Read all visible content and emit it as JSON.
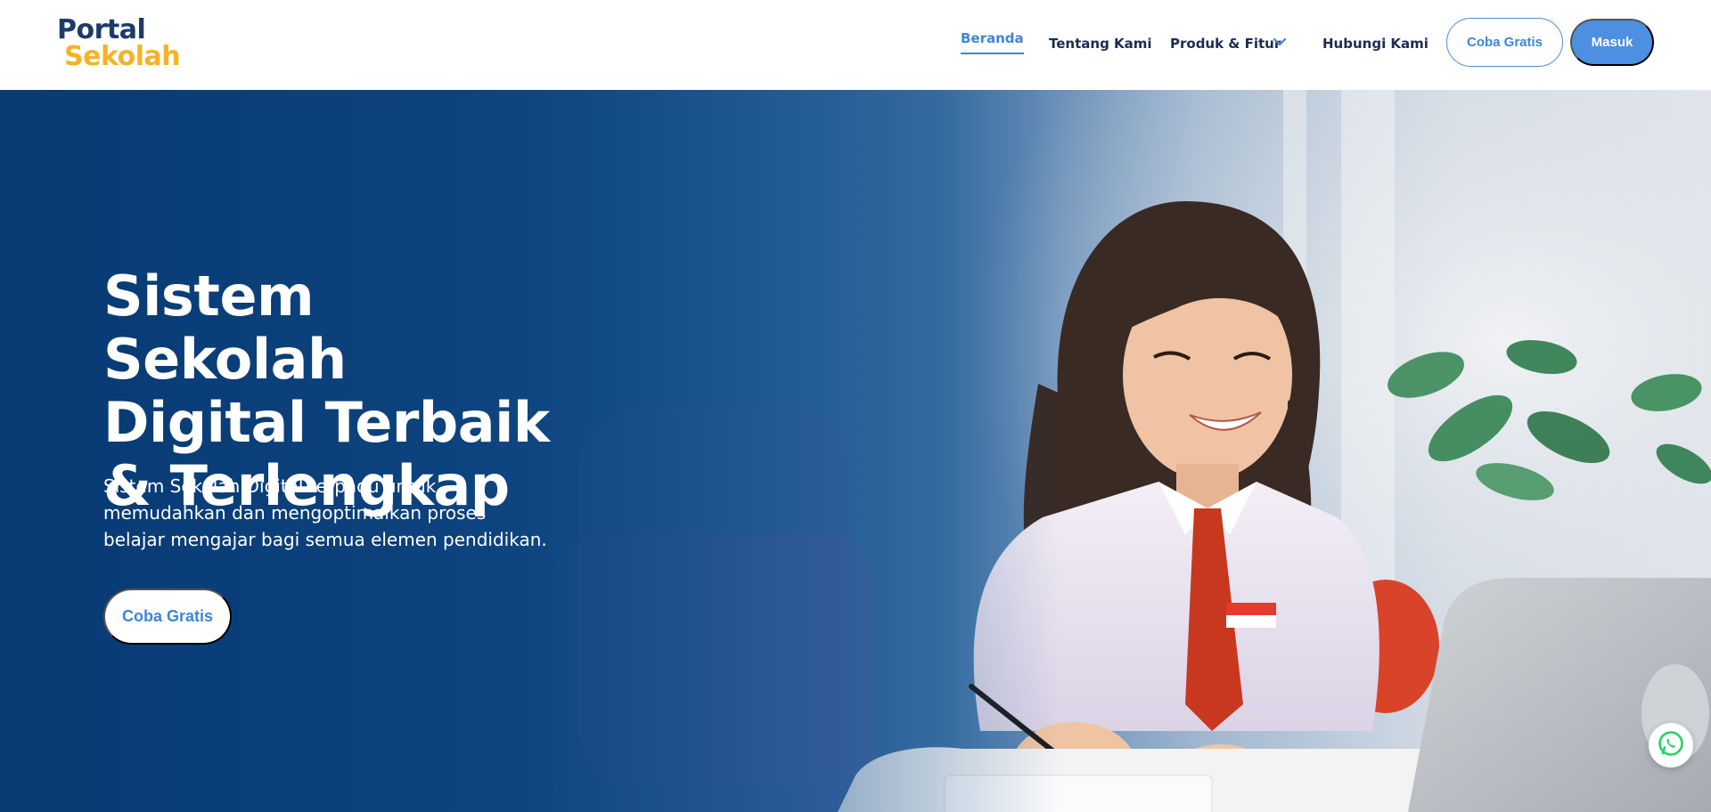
{
  "brand": {
    "line1": "Portal",
    "line2": "Sekolah",
    "color_primary": "#1e3a68",
    "color_accent": "#f5b324"
  },
  "nav": {
    "items": [
      {
        "label": "Beranda",
        "active": true
      },
      {
        "label": "Tentang Kami",
        "active": false
      },
      {
        "label": "Produk & Fitur",
        "active": false,
        "icon": "chevron-down-icon"
      },
      {
        "label": "Hubungi Kami",
        "active": false
      }
    ],
    "trial_button": "Coba Gratis",
    "login_button": "Masuk",
    "accent_color": "#3f84d8"
  },
  "hero": {
    "title_line1": "Sistem Sekolah",
    "title_line2": "Digital Terbaik",
    "title_line3": "& Terlengkap",
    "description": "Sistem Sekolah Digital terpadu untuk memudahkan dan mengoptimalkan proses belajar mengajar bagi semua elemen pendidikan.",
    "cta_label": "Coba Gratis",
    "background_color": "#0b3f78"
  },
  "floating": {
    "whatsapp_icon": "whatsapp-icon",
    "whatsapp_color": "#25d366"
  }
}
